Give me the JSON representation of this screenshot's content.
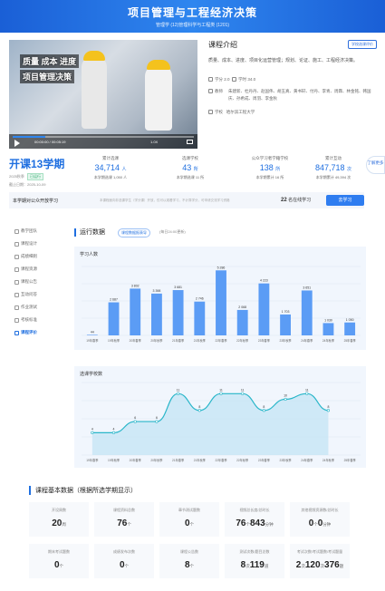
{
  "header": {
    "title": "项目管理与工程经济决策",
    "subtitle": "管理学 (12)管理科学与工程类 (1201)"
  },
  "video": {
    "banner_line1": "质量 成本 进度",
    "banner_line2": "项目管理决策",
    "time": "00:00:00 / 00:05:19",
    "speed": "1.0X",
    "progress": 0.18
  },
  "intro": {
    "title": "课程介绍",
    "badge": "学校选课评价",
    "desc": "质量、成本、进度、项目化运营管理；规划、论证、施工、工程经济决策。",
    "credits_label": "学分",
    "credits": "2.0",
    "hours_label": "学时",
    "hours": "34.0",
    "teachers_label": "教师",
    "teachers": "朱建新、杜丹丹、赵国伟、胡玉真、黄书轩、付丹、李青、周霖、林金铭、韩国庆、孙希成、周羽、李金秋",
    "school_label": "学校",
    "school": "哈尔滨工程大学"
  },
  "stats": {
    "semester": "开课13学期",
    "semester_year": "2025秋季",
    "semester_tag": "已运行",
    "semester_date": "截止日期：2025-10-09",
    "items": [
      {
        "label": "累计选课",
        "value": "34,714",
        "unit": "人",
        "sub": "本学期选课 1,050 人"
      },
      {
        "label": "选课学校",
        "value": "43",
        "unit": "所",
        "sub": "本学期选课 11 所"
      },
      {
        "label": "公众学习者学籍学校",
        "value": "138",
        "unit": "所",
        "sub": "本学期累计 16 所"
      },
      {
        "label": "累计互动",
        "value": "847,718",
        "unit": "次",
        "sub": "本学期累计 49,394 次"
      }
    ],
    "side_btn": "了解更多"
  },
  "join": {
    "label": "本学期对公众开放学习",
    "note": "本课程面向非选课学生（学分课）开放，仅可以观看学习，不计算学分，可申请交流学习资格",
    "count": "22",
    "count_label": "名在线学习",
    "button": "去学习"
  },
  "sidebar": [
    {
      "label": "教学团队",
      "icon": "team-icon",
      "active": false
    },
    {
      "label": "课程设计",
      "icon": "design-icon",
      "active": false
    },
    {
      "label": "成绩细则",
      "icon": "grading-icon",
      "active": false
    },
    {
      "label": "课程资源",
      "icon": "resource-icon",
      "active": false
    },
    {
      "label": "课程公告",
      "icon": "notice-icon",
      "active": false
    },
    {
      "label": "互动问答",
      "icon": "qa-icon",
      "active": false
    },
    {
      "label": "作业测试",
      "icon": "homework-icon",
      "active": false
    },
    {
      "label": "考核标准",
      "icon": "exam-icon",
      "active": false
    },
    {
      "label": "课程评价",
      "icon": "chart-icon",
      "active": true
    }
  ],
  "panel": {
    "title": "运行数据",
    "link": "课程数据报表导",
    "updated": "(每日24:00更新)"
  },
  "chart_data": [
    {
      "type": "bar",
      "title": "学习人数",
      "categories": [
        "19年春季",
        "19年秋季",
        "20年春季",
        "20年秋季",
        "21年春季",
        "21年秋季",
        "22年春季",
        "22年秋季",
        "23年春季",
        "23年秋季",
        "24年春季",
        "24年秋季",
        "25年春季"
      ],
      "values": [
        44,
        2687,
        3802,
        3398,
        3681,
        2746,
        5286,
        2068,
        4223,
        1700,
        3651,
        1000,
        1050
      ],
      "value_labels": [
        "44",
        "2 687",
        "3 802",
        "3 398",
        "3 681",
        "2 746",
        "5 286",
        "2 068",
        "4 223",
        "1 703",
        "3 651",
        "1 030",
        "1 050"
      ],
      "ylim": [
        0,
        5600
      ],
      "color": "#5b9cf5"
    },
    {
      "type": "area",
      "title": "选课学校数",
      "categories": [
        "19年春季",
        "19年秋季",
        "20年春季",
        "20年秋季",
        "21年春季",
        "21年秋季",
        "22年春季",
        "22年秋季",
        "23年春季",
        "23年秋季",
        "24年春季",
        "24年秋季",
        "25年春季"
      ],
      "values": [
        4,
        4,
        6,
        6,
        11,
        8,
        11,
        11,
        8,
        10,
        11,
        8
      ],
      "ylim": [
        0,
        13
      ],
      "color": "#29b6c9"
    }
  ],
  "basic": {
    "title": "课程基本数据（根据所选学期显示）",
    "cells": [
      {
        "label": "开设周数",
        "value": "20",
        "unit": "周"
      },
      {
        "label": "课程资料总数",
        "value": "76",
        "unit": "个"
      },
      {
        "label": "章节测试题数",
        "value": "0",
        "unit": "个"
      },
      {
        "label": "视频总长度/总时长",
        "value": "76",
        "mid": "843",
        "unit": "分钟",
        "mid_unit": "个"
      },
      {
        "label": "其他视频资源数/总时长",
        "value": "0",
        "mid": "0",
        "unit": "分钟",
        "mid_unit": "个"
      },
      {
        "label": "期末考试题数",
        "value": "0",
        "unit": "个"
      },
      {
        "label": "成绩发布次数",
        "value": "0",
        "unit": "个"
      },
      {
        "label": "课程公告数",
        "value": "8",
        "unit": "个"
      },
      {
        "label": "测试次数/题目总数",
        "value": "8",
        "mid": "119",
        "unit": "道",
        "mid_unit": "次"
      },
      {
        "label": "考试次数/考试题数/考试题量",
        "value": "2",
        "mid": "120",
        "mid2": "376",
        "unit": "题",
        "mid_unit": "次"
      }
    ]
  }
}
